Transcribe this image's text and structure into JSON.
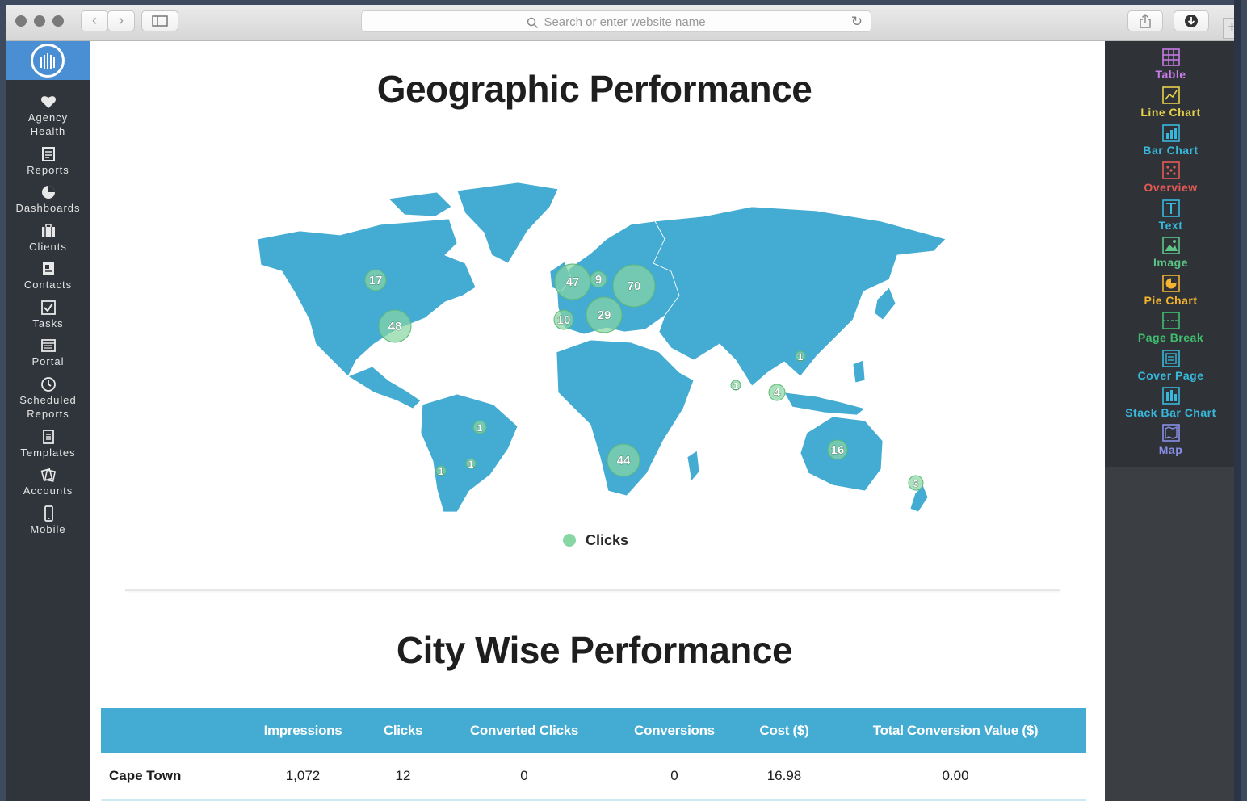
{
  "browser": {
    "address_placeholder": "Search or enter website name",
    "back_icon": "chevron-left-icon",
    "forward_icon": "chevron-right-icon"
  },
  "sidebar": {
    "items": [
      {
        "label_1": "Agency",
        "label_2": "Health",
        "icon": "heart-icon"
      },
      {
        "label_1": "Reports",
        "icon": "report-icon"
      },
      {
        "label_1": "Dashboards",
        "icon": "pie-icon"
      },
      {
        "label_1": "Clients",
        "icon": "briefcase-icon"
      },
      {
        "label_1": "Contacts",
        "icon": "address-book-icon"
      },
      {
        "label_1": "Tasks",
        "icon": "checkbox-icon"
      },
      {
        "label_1": "Portal",
        "icon": "portal-icon"
      },
      {
        "label_1": "Scheduled",
        "label_2": "Reports",
        "icon": "clock-icon"
      },
      {
        "label_1": "Templates",
        "icon": "template-icon"
      },
      {
        "label_1": "Accounts",
        "icon": "accounts-icon"
      },
      {
        "label_1": "Mobile",
        "icon": "mobile-icon"
      }
    ]
  },
  "main": {
    "geo_title": "Geographic Performance",
    "city_title": "City Wise Performance",
    "map": {
      "legend": "Clicks",
      "legend_color": "#88d6a3",
      "land_color": "#44acd2",
      "bubbles": [
        {
          "value": "17"
        },
        {
          "value": "48"
        },
        {
          "value": "47"
        },
        {
          "value": "9"
        },
        {
          "value": "70"
        },
        {
          "value": "10"
        },
        {
          "value": "29"
        },
        {
          "value": "1"
        },
        {
          "value": "1"
        },
        {
          "value": "1"
        },
        {
          "value": "1"
        },
        {
          "value": "1"
        },
        {
          "value": "44"
        },
        {
          "value": "4"
        },
        {
          "value": "16"
        },
        {
          "value": "3"
        }
      ]
    },
    "table": {
      "headers": [
        "",
        "Impressions",
        "Clicks",
        "Converted Clicks",
        "Conversions",
        "Cost ($)",
        "Total Conversion Value ($)"
      ],
      "rows": [
        [
          "Cape Town",
          "1,072",
          "12",
          "0",
          "0",
          "16.98",
          "0.00"
        ]
      ]
    }
  },
  "right_panel": {
    "items": [
      {
        "label": "Table",
        "color": "#c77ce6",
        "icon": "table-icon"
      },
      {
        "label": "Line Chart",
        "color": "#e8d24a",
        "icon": "line-chart-icon"
      },
      {
        "label": "Bar Chart",
        "color": "#38b8dc",
        "icon": "bar-chart-icon"
      },
      {
        "label": "Overview",
        "color": "#e45a55",
        "icon": "overview-icon"
      },
      {
        "label": "Text",
        "color": "#38b8dc",
        "icon": "text-icon"
      },
      {
        "label": "Image",
        "color": "#5cc585",
        "icon": "image-icon"
      },
      {
        "label": "Pie Chart",
        "color": "#f5b430",
        "icon": "pie-chart-icon"
      },
      {
        "label": "Page Break",
        "color": "#3fbf6e",
        "icon": "page-break-icon"
      },
      {
        "label": "Cover Page",
        "color": "#38b8dc",
        "icon": "cover-page-icon"
      },
      {
        "label": "Stack Bar Chart",
        "color": "#38b8dc",
        "icon": "stack-bar-chart-icon"
      },
      {
        "label": "Map",
        "color": "#8a8ee6",
        "icon": "map-icon"
      }
    ]
  }
}
